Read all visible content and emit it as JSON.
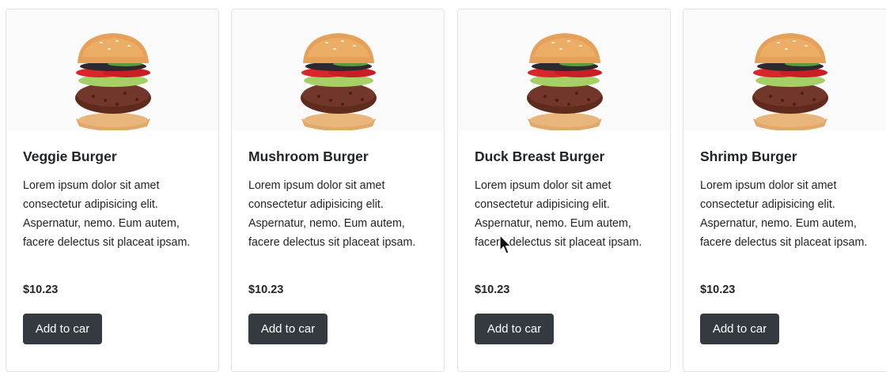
{
  "products": [
    {
      "name": "Veggie Burger",
      "description": "Lorem ipsum dolor sit amet consectetur adipisicing elit. Aspernatur, nemo. Eum autem, facere delectus sit placeat ipsam.",
      "price": "$10.23",
      "button_label": "Add to car",
      "image_icon": "burger-image"
    },
    {
      "name": "Mushroom Burger",
      "description": "Lorem ipsum dolor sit amet consectetur adipisicing elit. Aspernatur, nemo. Eum autem, facere delectus sit placeat ipsam.",
      "price": "$10.23",
      "button_label": "Add to car",
      "image_icon": "burger-image"
    },
    {
      "name": "Duck Breast Burger",
      "description": "Lorem ipsum dolor sit amet consectetur adipisicing elit. Aspernatur, nemo. Eum autem, facere delectus sit placeat ipsam.",
      "price": "$10.23",
      "button_label": "Add to car",
      "image_icon": "burger-image"
    },
    {
      "name": "Shrimp Burger",
      "description": "Lorem ipsum dolor sit amet consectetur adipisicing elit. Aspernatur, nemo. Eum autem, facere delectus sit placeat ipsam.",
      "price": "$10.23",
      "button_label": "Add to car",
      "image_icon": "burger-image"
    }
  ],
  "colors": {
    "button_bg": "#343a40",
    "button_text": "#ffffff",
    "text": "#212529",
    "card_border": "#e3e3e3"
  }
}
